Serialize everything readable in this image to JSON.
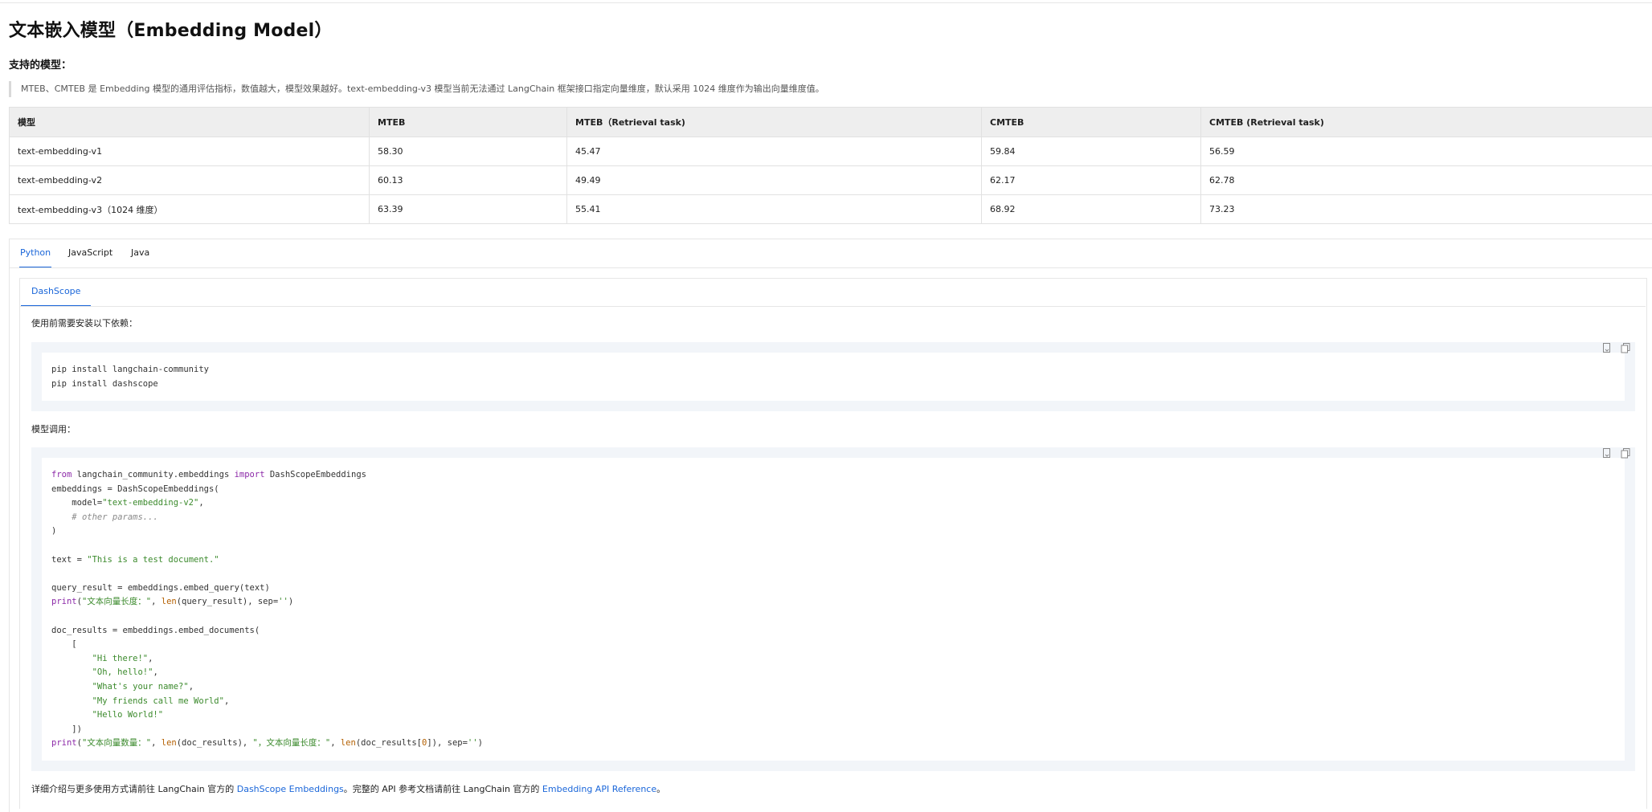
{
  "page": {
    "title": "文本嵌入模型（Embedding Model）",
    "subtitle": "支持的模型：",
    "note": "MTEB、CMTEB 是 Embedding 模型的通用评估指标，数值越大，模型效果越好。text-embedding-v3 模型当前无法通过 LangChain 框架接口指定向量维度，默认采用 1024 维度作为输出向量维度值。"
  },
  "table": {
    "headers": [
      "模型",
      "MTEB",
      "MTEB（Retrieval task)",
      "CMTEB",
      "CMTEB (Retrieval task)"
    ],
    "rows": [
      [
        "text-embedding-v1",
        "58.30",
        "45.47",
        "59.84",
        "56.59"
      ],
      [
        "text-embedding-v2",
        "60.13",
        "49.49",
        "62.17",
        "62.78"
      ],
      [
        "text-embedding-v3（1024 维度）",
        "63.39",
        "55.41",
        "68.92",
        "73.23"
      ]
    ]
  },
  "lang_tabs": [
    "Python",
    "JavaScript",
    "Java"
  ],
  "active_lang_tab": "Python",
  "inner_tab": "DashScope",
  "install_label": "使用前需要安装以下依赖：",
  "install_code": [
    "pip install langchain-community",
    "pip install dashscope"
  ],
  "invoke_label": "模型调用：",
  "footer": {
    "pre": "详细介绍与更多使用方式请前往 LangChain 官方的 ",
    "link1": "DashScope Embeddings",
    "mid": "。完整的 API 参考文档请前往 LangChain 官方的 ",
    "link2": "Embedding API Reference",
    "post": "。"
  },
  "icons": [
    "view-source-icon",
    "copy-icon"
  ]
}
